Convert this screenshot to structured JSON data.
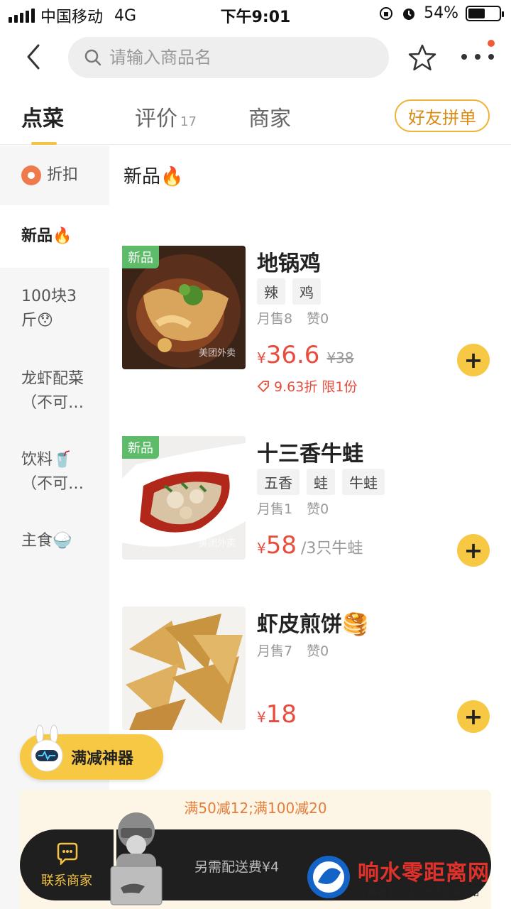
{
  "status": {
    "carrier": "中国移动",
    "network": "4G",
    "time": "下午9:01",
    "battery_pct": "54%",
    "battery_level": 0.54
  },
  "header": {
    "search_placeholder": "请输入商品名"
  },
  "tabs": [
    {
      "label": "点菜",
      "active": true
    },
    {
      "label": "评价",
      "count": "17"
    },
    {
      "label": "商家"
    }
  ],
  "group_order_label": "好友拼单",
  "sidebar": {
    "items": [
      {
        "label": "折扣"
      },
      {
        "label": "新品🔥",
        "active": true
      },
      {
        "label": "100块3斤😯"
      },
      {
        "label": "龙虾配菜（不可…"
      },
      {
        "label": "饮料🥤（不可…"
      },
      {
        "label": "主食🍚"
      }
    ]
  },
  "section_title": "新品🔥",
  "products": [
    {
      "badge": "新品",
      "name": "地锅鸡",
      "tags": [
        "辣",
        "鸡"
      ],
      "monthly_sales": "月售8",
      "likes": "赞0",
      "price_symbol": "¥",
      "price": "36.6",
      "old_price": "¥38",
      "discount": "9.63折 限1份",
      "watermark": "美团外卖"
    },
    {
      "badge": "新品",
      "name": "十三香牛蛙",
      "tags": [
        "五香",
        "蛙",
        "牛蛙"
      ],
      "monthly_sales": "月售1",
      "likes": "赞0",
      "price_symbol": "¥",
      "price": "58",
      "unit": "/3只牛蛙",
      "watermark": "美团外卖"
    },
    {
      "name": "虾皮煎饼🥞",
      "monthly_sales": "月售7",
      "likes": "赞0",
      "price_symbol": "¥",
      "price": "18"
    }
  ],
  "promo_float_label": "满减神器",
  "discount_banner": "满50减12;满100减20",
  "bottom": {
    "contact_label": "联系商家",
    "delivery_fee": "另需配送费¥4"
  },
  "watermark_brand": {
    "name": "响水零距离网",
    "slogan": "了解响水，从响水零距离开始"
  }
}
